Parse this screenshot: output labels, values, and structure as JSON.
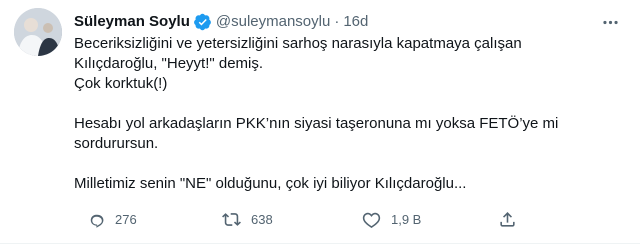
{
  "tweet": {
    "author_name": "Süleyman Soylu",
    "handle": "@suleymansoylu",
    "separator": "·",
    "time": "16d",
    "lines": [
      "Beceriksizliğini ve yetersizliğini sarhoş narasıyla kapatmaya çalışan",
      "Kılıçdaroğlu, \"Heyyt!\" demiş.",
      "Çok korktuk(!)",
      "",
      "Hesabı yol arkadaşların PKK’nın siyasi taşeronuna mı yoksa FETÖ’ye mi",
      "sordurursun.",
      "",
      "Milletimiz senin \"NE\" olduğunu, çok iyi biliyor Kılıçdaroğlu..."
    ],
    "stats": {
      "replies": "276",
      "retweets": "638",
      "likes": "1,9 B"
    }
  },
  "icons": {
    "verified": "verified-badge-icon",
    "more": "more-options-icon",
    "reply": "reply-icon",
    "retweet": "retweet-icon",
    "like": "heart-icon",
    "share": "share-icon"
  },
  "colors": {
    "verified": "#1d9bf0",
    "text": "#0f1419",
    "secondary": "#536471"
  }
}
